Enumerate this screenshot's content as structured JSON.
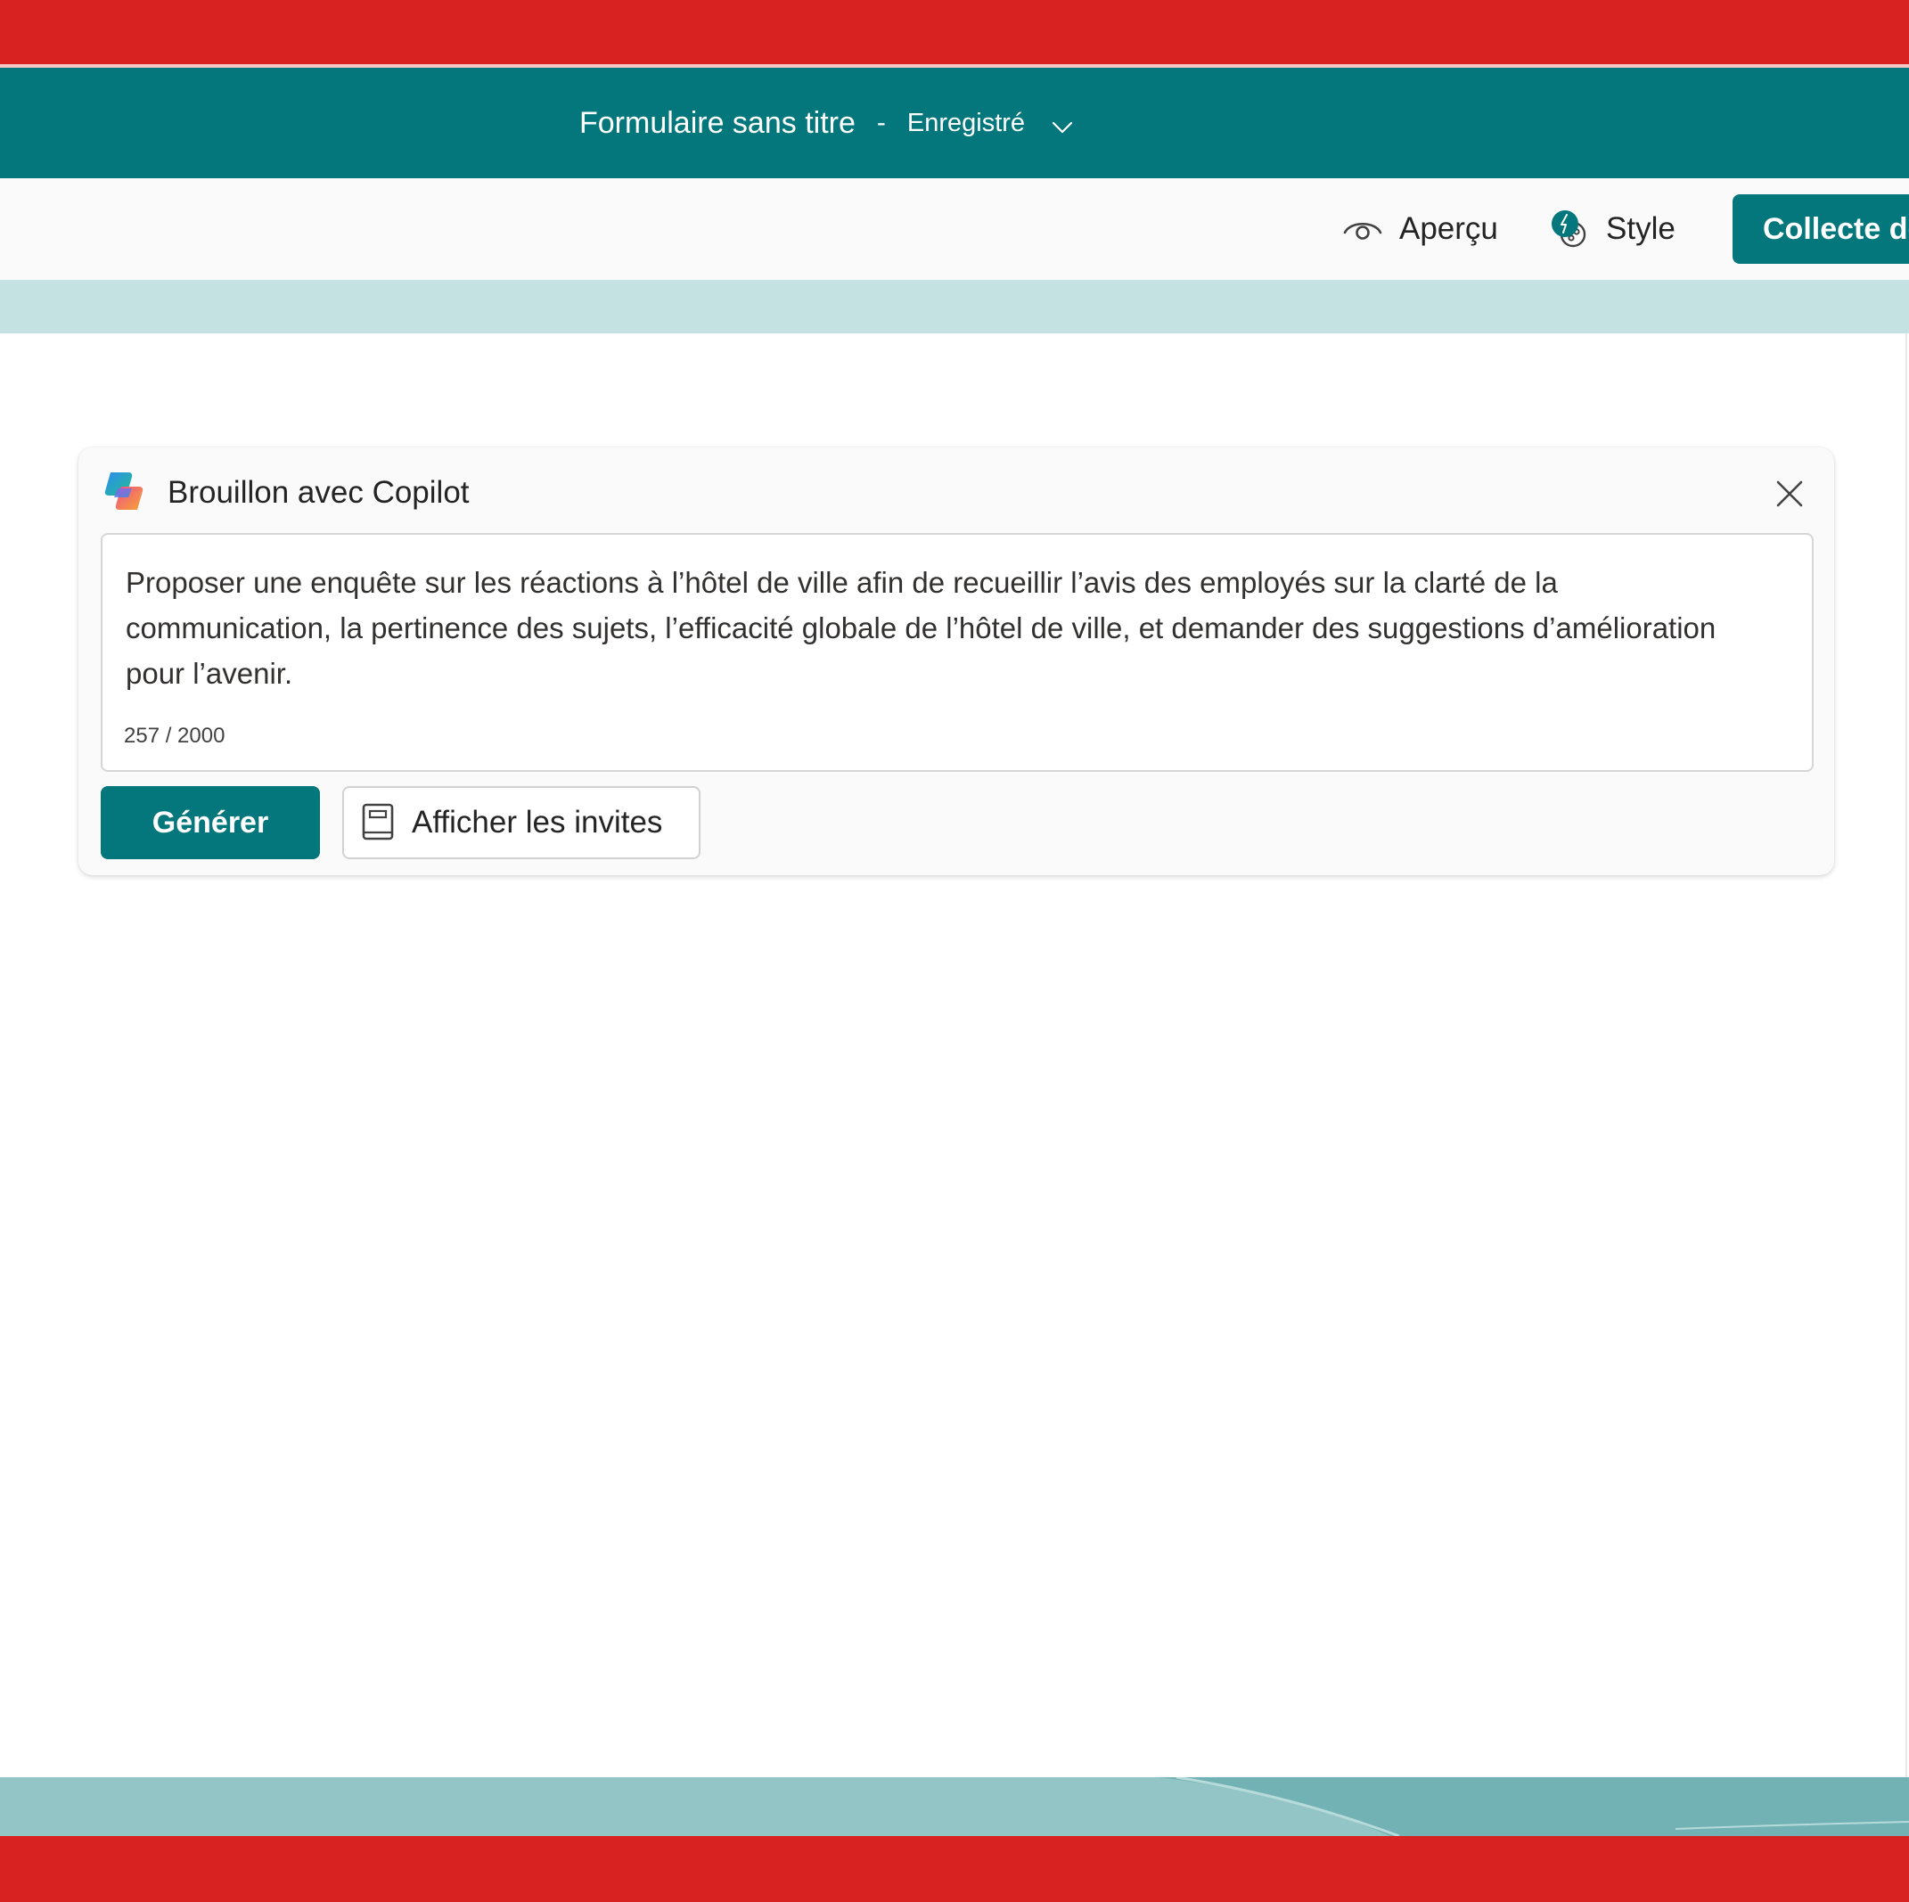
{
  "header": {
    "form_title": "Formulaire sans titre",
    "separator": "-",
    "save_status": "Enregistré"
  },
  "commandbar": {
    "preview_label": "Aperçu",
    "style_label": "Style",
    "collect_label": "Collecte de"
  },
  "copilot": {
    "title": "Brouillon avec Copilot",
    "prompt_text": "Proposer une enquête sur les réactions à l’hôtel de ville afin de recueillir l’avis des employés sur la clarté de la communication, la pertinence des sujets, l’efficacité globale de l’hôtel de ville, et demander des suggestions d’amélioration pour l’avenir.",
    "char_count": "257 / 2000",
    "generate_label": "Générer",
    "show_prompts_label": "Afficher les invites"
  },
  "colors": {
    "brand_red": "#d82222",
    "brand_teal": "#04777c",
    "band_teal": "#c5e2e3",
    "footer_teal": "#93c4c6"
  },
  "icons": {
    "chevron": "chevron-down-icon",
    "preview": "eye-icon",
    "style": "palette-icon",
    "copilot": "copilot-logo-icon",
    "close": "close-icon",
    "prompts": "book-icon"
  }
}
